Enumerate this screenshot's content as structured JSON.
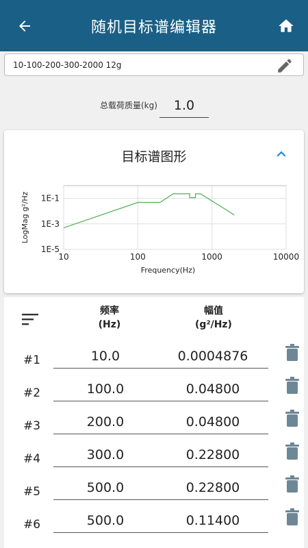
{
  "app": {
    "title": "随机目标谱编辑器"
  },
  "profile": {
    "name": "10-100-200-300-2000 12g"
  },
  "mass": {
    "label": "总载荷质量(kg)",
    "value": "1.0"
  },
  "chart_card": {
    "title": "目标谱图形"
  },
  "chart_data": {
    "type": "line",
    "xlabel": "Frequency(Hz)",
    "ylabel": "LogMag g²/Hz",
    "x_scale": "log",
    "y_scale": "log",
    "xlim": [
      10,
      10000
    ],
    "ylim": [
      1e-05,
      1
    ],
    "x_ticks": [
      "10",
      "100",
      "1000",
      "10000"
    ],
    "y_ticks": [
      "1E-1",
      "1E-3",
      "1E-5"
    ],
    "grid": true,
    "series_color": "#4caf50",
    "x": [
      10,
      100,
      200,
      300,
      500,
      500,
      600,
      600,
      700,
      2000
    ],
    "y": [
      0.0004876,
      0.048,
      0.048,
      0.228,
      0.228,
      0.114,
      0.114,
      0.228,
      0.228,
      0.005
    ]
  },
  "table": {
    "freq_header": [
      "频率",
      "(Hz)"
    ],
    "amp_header": [
      "幅值",
      "(g²/Hz)"
    ],
    "rows": [
      {
        "index": "#1",
        "freq": "10.0",
        "amp": "0.0004876"
      },
      {
        "index": "#2",
        "freq": "100.0",
        "amp": "0.04800"
      },
      {
        "index": "#3",
        "freq": "200.0",
        "amp": "0.04800"
      },
      {
        "index": "#4",
        "freq": "300.0",
        "amp": "0.22800"
      },
      {
        "index": "#5",
        "freq": "500.0",
        "amp": "0.22800"
      },
      {
        "index": "#6",
        "freq": "500.0",
        "amp": "0.11400"
      }
    ]
  },
  "colors": {
    "appbar": "#1a5f85",
    "accent": "#1e88e5",
    "delete_icon": "#6e8796"
  }
}
